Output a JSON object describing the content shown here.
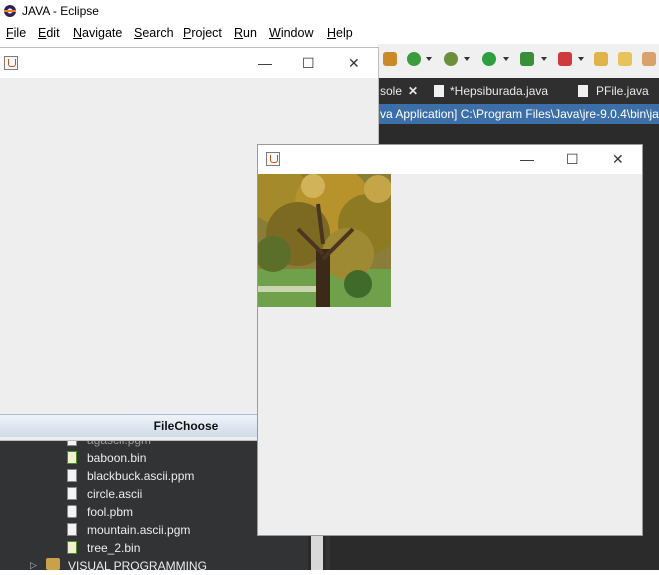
{
  "window": {
    "title": "JAVA - Eclipse"
  },
  "menu": [
    "File",
    "Edit",
    "Navigate",
    "Search",
    "Project",
    "Run",
    "Window",
    "Help"
  ],
  "editor_tabs": [
    {
      "label": "sole",
      "close": "✕"
    },
    {
      "label": "*Hepsiburada.java"
    },
    {
      "label": "PFile.java"
    }
  ],
  "console_header": "va Application] C:\\Program Files\\Java\\jre-9.0.4\\bin\\ja",
  "frame_controls": {
    "minimize": "—",
    "maximize": "☐",
    "close": "✕"
  },
  "file_choose": {
    "label": "FileChoose"
  },
  "explorer": {
    "items": [
      {
        "name": "agascii.pgm",
        "type": "text"
      },
      {
        "name": "baboon.bin",
        "type": "bin"
      },
      {
        "name": "blackbuck.ascii.ppm",
        "type": "text"
      },
      {
        "name": "circle.ascii",
        "type": "text"
      },
      {
        "name": "fool.pbm",
        "type": "image"
      },
      {
        "name": "mountain.ascii.pgm",
        "type": "text"
      },
      {
        "name": "tree_2.bin",
        "type": "bin"
      }
    ],
    "project": "VISUAL PROGRAMMING"
  },
  "icons": [
    "eclipse-icon",
    "java-frame-icon",
    "minimize-icon",
    "maximize-icon",
    "close-icon",
    "file-icon",
    "folder-icon"
  ]
}
